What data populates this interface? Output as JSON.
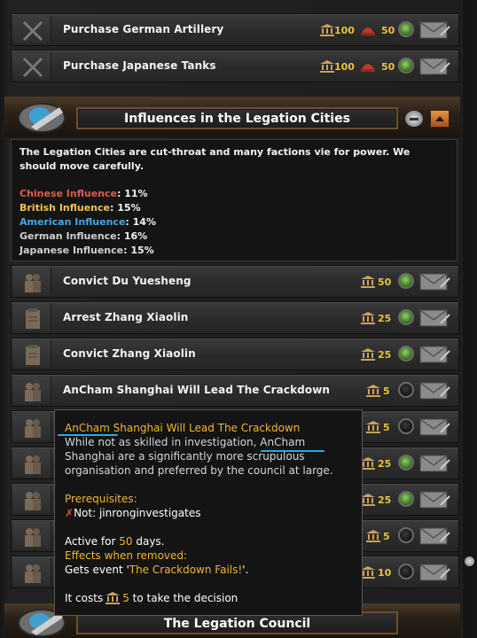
{
  "decisions_top": [
    {
      "label": "Purchase German Artillery",
      "pp": "100",
      "manpower": "50",
      "status": "available",
      "icon": "crossed-rifles-icon"
    },
    {
      "label": "Purchase Japanese Tanks",
      "pp": "100",
      "manpower": "50",
      "status": "available",
      "icon": "crossed-rifles-icon"
    }
  ],
  "section": {
    "title": "Influences in the Legation Cities",
    "description": "The Legation Cities are cut-throat and many factions vie for power. We should move carefully.",
    "influences": [
      {
        "name": "Chinese Influence",
        "value": "11%",
        "color": "#e05a50"
      },
      {
        "name": "British Influence",
        "value": "15%",
        "color": "#f0c44a"
      },
      {
        "name": "American Influence",
        "value": "14%",
        "color": "#3fa9e6"
      },
      {
        "name": "German Influence",
        "value": "16%",
        "color": "#cfcfcf"
      },
      {
        "name": "Japanese Influence",
        "value": "15%",
        "color": "#cfcfcf"
      }
    ]
  },
  "decisions": [
    {
      "label": "Convict Du Yuesheng",
      "cost": "50",
      "status": "available",
      "icon": "people-icon"
    },
    {
      "label": "Arrest Zhang Xiaolin",
      "cost": "25",
      "status": "available",
      "icon": "clipboard-icon"
    },
    {
      "label": "Convict Zhang Xiaolin",
      "cost": "25",
      "status": "available",
      "icon": "clipboard-icon"
    },
    {
      "label": "AnCham Shanghai Will Lead The Crackdown",
      "cost": "5",
      "status": "unavailable",
      "icon": "people-icon"
    },
    {
      "label": "",
      "cost": "5",
      "status": "unavailable",
      "icon": "people-icon"
    },
    {
      "label": "",
      "cost": "25",
      "status": "available",
      "icon": "people-icon"
    },
    {
      "label": "",
      "cost": "25",
      "status": "available",
      "icon": "people-icon"
    },
    {
      "label": "",
      "cost": "5",
      "status": "unavailable",
      "icon": "people-icon"
    },
    {
      "label": "",
      "cost": "10",
      "status": "unavailable",
      "icon": "people-icon"
    }
  ],
  "tooltip": {
    "title": "AnCham Shanghai Will Lead The Crackdown",
    "body_line1": "While not as skilled in investigation, AnCham",
    "body_line2": "Shanghai are a significantly more scrupulous",
    "body_line3": "organisation and preferred by the council at large.",
    "prereq_heading": "Prerequisites:",
    "prereq_item": "Not: jinronginvestigates",
    "active_prefix": "Active for ",
    "active_days": "50",
    "active_suffix": " days.",
    "effects_heading": "Effects when removed:",
    "event_prefix": "Gets event '",
    "event_name": "The Crackdown Fails!",
    "event_suffix": "'.",
    "cost_prefix": "It costs ",
    "cost_value": "5",
    "cost_suffix": " to take the decision"
  },
  "bottom_section": {
    "title": "The Legation Council"
  },
  "colors": {
    "accent_gold": "#e6c33d",
    "tooltip_yellow": "#f0b62e",
    "underline_blue": "#2fa8d8"
  }
}
